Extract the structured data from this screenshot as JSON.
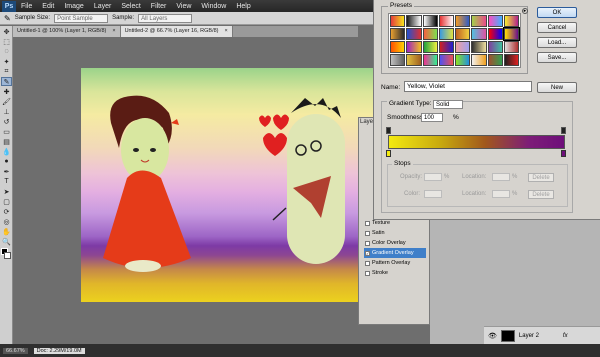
{
  "menubar": {
    "logo": "Ps",
    "items": [
      "File",
      "Edit",
      "Image",
      "Layer",
      "Select",
      "Filter",
      "View",
      "Window",
      "Help"
    ]
  },
  "options": {
    "sample_size_label": "Sample Size:",
    "sample_size_value": "Point Sample",
    "sample_label": "Sample:",
    "sample_value": "All Layers"
  },
  "tabs": [
    {
      "label": "Untitled-1 @ 100% (Layer 1, RGB/8)",
      "close": "×"
    },
    {
      "label": "Untitled-2 @ 66.7% (Layer 16, RGB/8)",
      "close": "×"
    }
  ],
  "gradient_editor": {
    "presets_label": "Presets",
    "ok_label": "OK",
    "cancel_label": "Cancel",
    "load_label": "Load...",
    "save_label": "Save...",
    "name_label": "Name:",
    "name_value": "Yellow, Violet",
    "new_label": "New",
    "gradient_type_label": "Gradient Type:",
    "gradient_type_value": "Solid",
    "smoothness_label": "Smoothness:",
    "smoothness_value": "100",
    "smoothness_unit": "%",
    "stops_label": "Stops",
    "opacity_label": "Opacity:",
    "location_label": "Location:",
    "color_label": "Color:",
    "percent": "%",
    "delete_label": "Delete",
    "gradient_start": "#f3ea10",
    "gradient_end": "#6e0e7a",
    "presets": [
      "#e43d3d,#f6e21b",
      "#1a1a1a,#ffffff",
      "#ffffff,#000000",
      "#e63535,#ffffff",
      "#f39a26,#2f5cc7",
      "#a3d04a,#ea4a8a",
      "#ff4dbf,#3fb1ff",
      "#f9ef30,#b1218c",
      "#e7a030,#2b2b2b",
      "#2050d0,#e03030",
      "#f46040,#7be04f",
      "#3a9ae0,#e0e040",
      "#c06020,#f0d040",
      "#50c0e0,#e050a0",
      "#ff0000,#0000ff",
      "#ffe000,#6a0d8d",
      "#ff5000,#ffd000",
      "#a020c0,#f0c020",
      "#20a040,#f0f040",
      "#d02020,#2020d0",
      "#f0a0a0,#a0a0f0",
      "#303030,#f0e0a0",
      "#8040a0,#40c0a0",
      "#e0e0e0,#b03030",
      "#c0c0c0,#606060",
      "#e0c040,#a06020",
      "#f03090,#30f090",
      "#5050f0,#f05050",
      "#90e020,#2090e0",
      "#f0f0f0,#f0a020",
      "#a05030,#30a050",
      "#202020,#e02020"
    ]
  },
  "layer_style": {
    "title": "Layer",
    "items": [
      {
        "label": "Texture",
        "checked": false
      },
      {
        "label": "Satin",
        "checked": false
      },
      {
        "label": "Color Overlay",
        "checked": false
      },
      {
        "label": "Gradient Overlay",
        "checked": true
      },
      {
        "label": "Pattern Overlay",
        "checked": false
      },
      {
        "label": "Stroke",
        "checked": false
      }
    ]
  },
  "layers_panel": {
    "layer_name": "Layer 2",
    "fx_label": "fx"
  },
  "statusbar": {
    "zoom": "66.67%",
    "doc_label": "Doc: 2.29M/19.0M"
  }
}
